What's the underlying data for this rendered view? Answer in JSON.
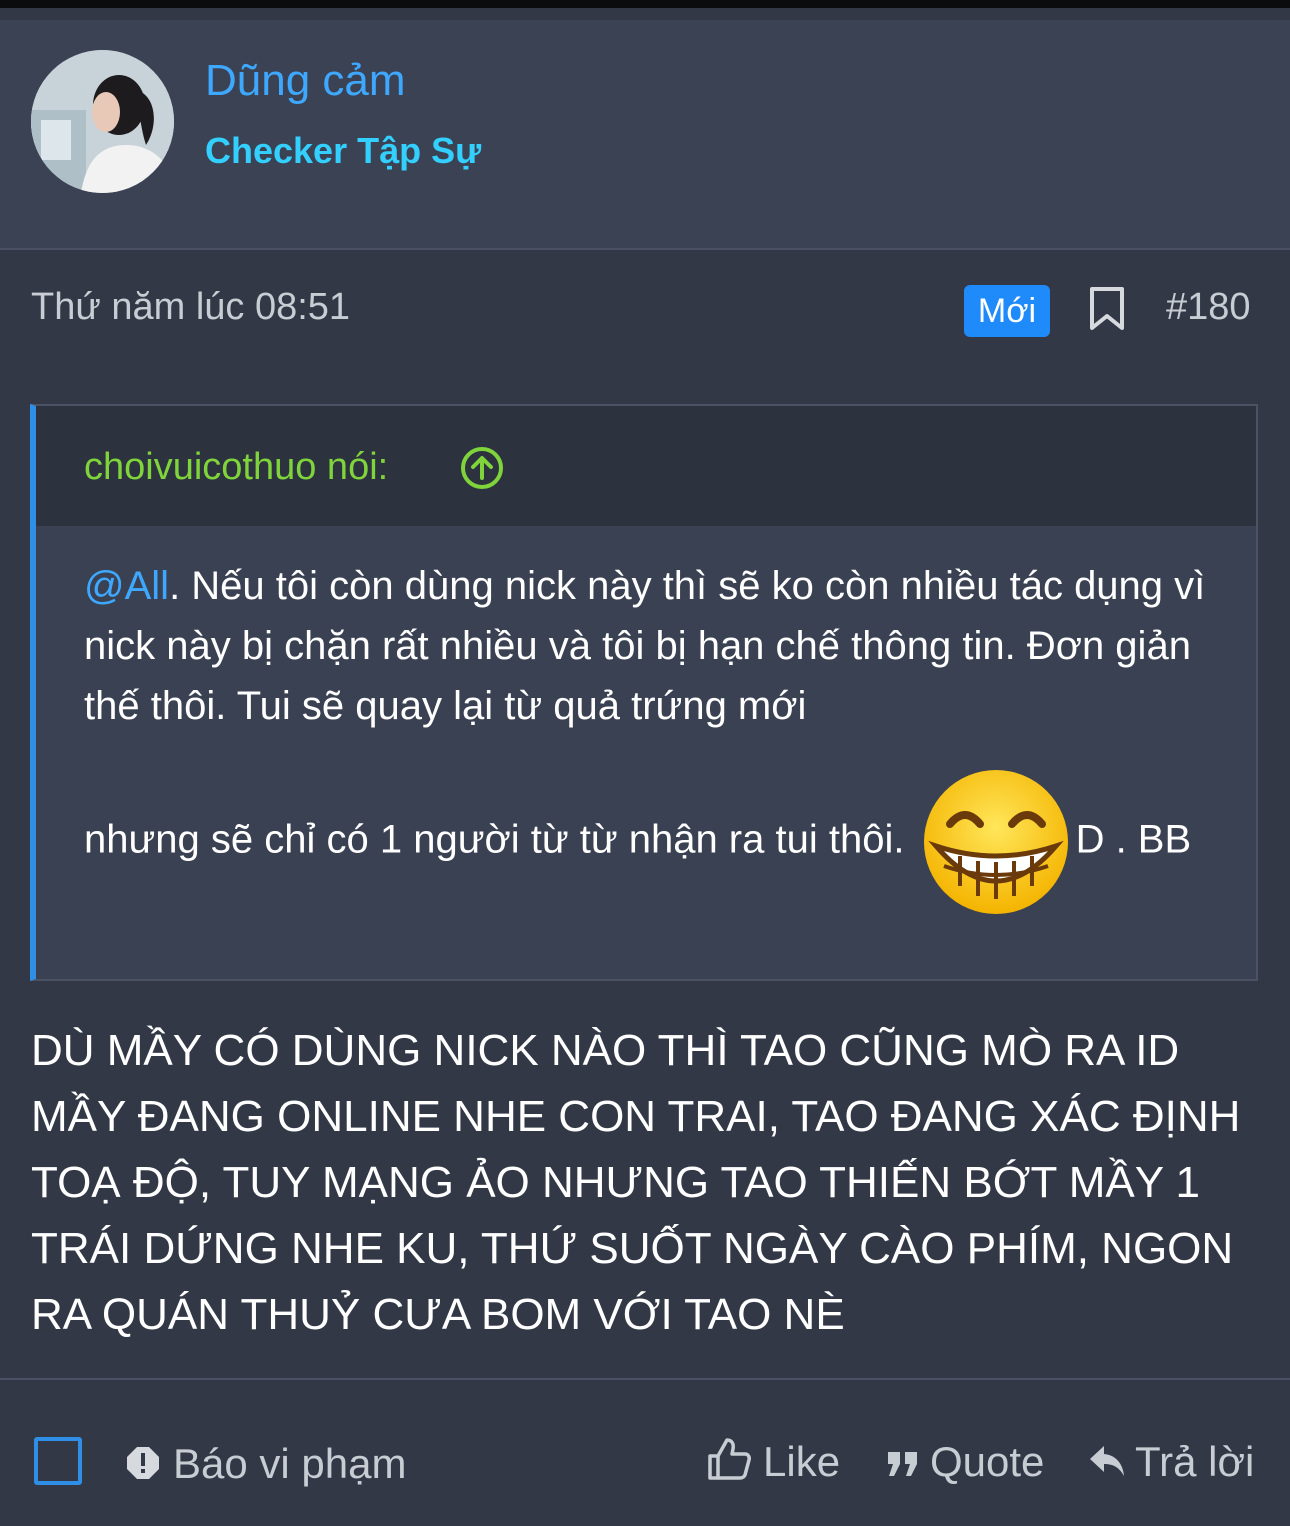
{
  "user": {
    "name": "Dũng cảm",
    "title": "Checker Tập Sự"
  },
  "post": {
    "date": "Thứ năm lúc 08:51",
    "badge": "Mới",
    "number": "#180",
    "body": "DÙ MẦY CÓ DÙNG NICK NÀO THÌ TAO CŨNG MÒ RA ID MẦY ĐANG ONLINE NHE CON TRAI, TAO ĐANG XÁC ĐỊNH TOẠ ĐỘ, TUY MẠNG ẢO NHƯNG TAO THIẾN BỚT MẦY 1 TRÁI DỨNG NHE KU, THỨ SUỐT NGÀY CÀO PHÍM, NGON RA QUÁN THUỶ CƯA BOM VỚI TAO NÈ"
  },
  "quote": {
    "author": "choivuicothuo nói:",
    "mention": "@All",
    "text_part1": ". Nếu tôi còn dùng nick này thì sẽ ko còn nhiều tác dụng vì nick này bị chặn rất nhiều và tôi bị hạn chế thông tin. Đơn giản thế thôi. Tui sẽ quay lại từ quả trứng mới",
    "text_part2": "nhưng sẽ chỉ có 1 người từ từ nhận ra tui thôi.",
    "text_part3": "D . BB",
    "emoji": "grinning-face-emoji"
  },
  "actions": {
    "report": "Báo vi phạm",
    "like": "Like",
    "quote": "Quote",
    "reply": "Trả lời"
  },
  "colors": {
    "background": "#323846",
    "header_bg": "#3b4253",
    "accent_blue": "#1f8bfa",
    "username": "#3ea8ff",
    "user_title": "#33d0ff",
    "quote_author": "#7fd43b"
  }
}
